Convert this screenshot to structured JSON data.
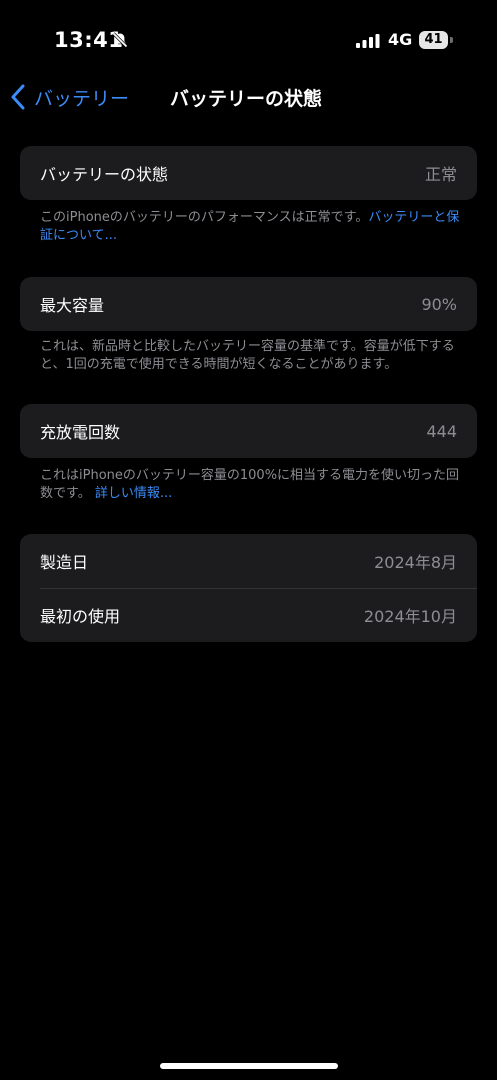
{
  "status_bar": {
    "time": "13:41",
    "network": "4G",
    "battery_level": "41",
    "icons": [
      "bell-slash-icon",
      "cellular-signal-icon",
      "battery-icon"
    ]
  },
  "nav": {
    "back_label": "バッテリー",
    "title": "バッテリーの状態",
    "back_icon": "chevron-left-icon"
  },
  "health": {
    "label": "バッテリーの状態",
    "value": "正常",
    "footer_text": "このiPhoneのバッテリーのパフォーマンスは正常です。",
    "footer_link": "バッテリーと保証について..."
  },
  "capacity": {
    "label": "最大容量",
    "value": "90%",
    "footer_text": "これは、新品時と比較したバッテリー容量の基準です。容量が低下すると、1回の充電で使用できる時間が短くなることがあります。"
  },
  "cycles": {
    "label": "充放電回数",
    "value": "444",
    "footer_text": "これはiPhoneのバッテリー容量の100%に相当する電力を使い切った回数です。",
    "footer_link": "詳しい情報..."
  },
  "info": {
    "manufacture_label": "製造日",
    "manufacture_value": "2024年8月",
    "first_use_label": "最初の使用",
    "first_use_value": "2024年10月"
  },
  "colors": {
    "background": "#000000",
    "cell": "#1c1c1e",
    "accent": "#3c8bf6",
    "secondary_text": "#8d8d93"
  }
}
